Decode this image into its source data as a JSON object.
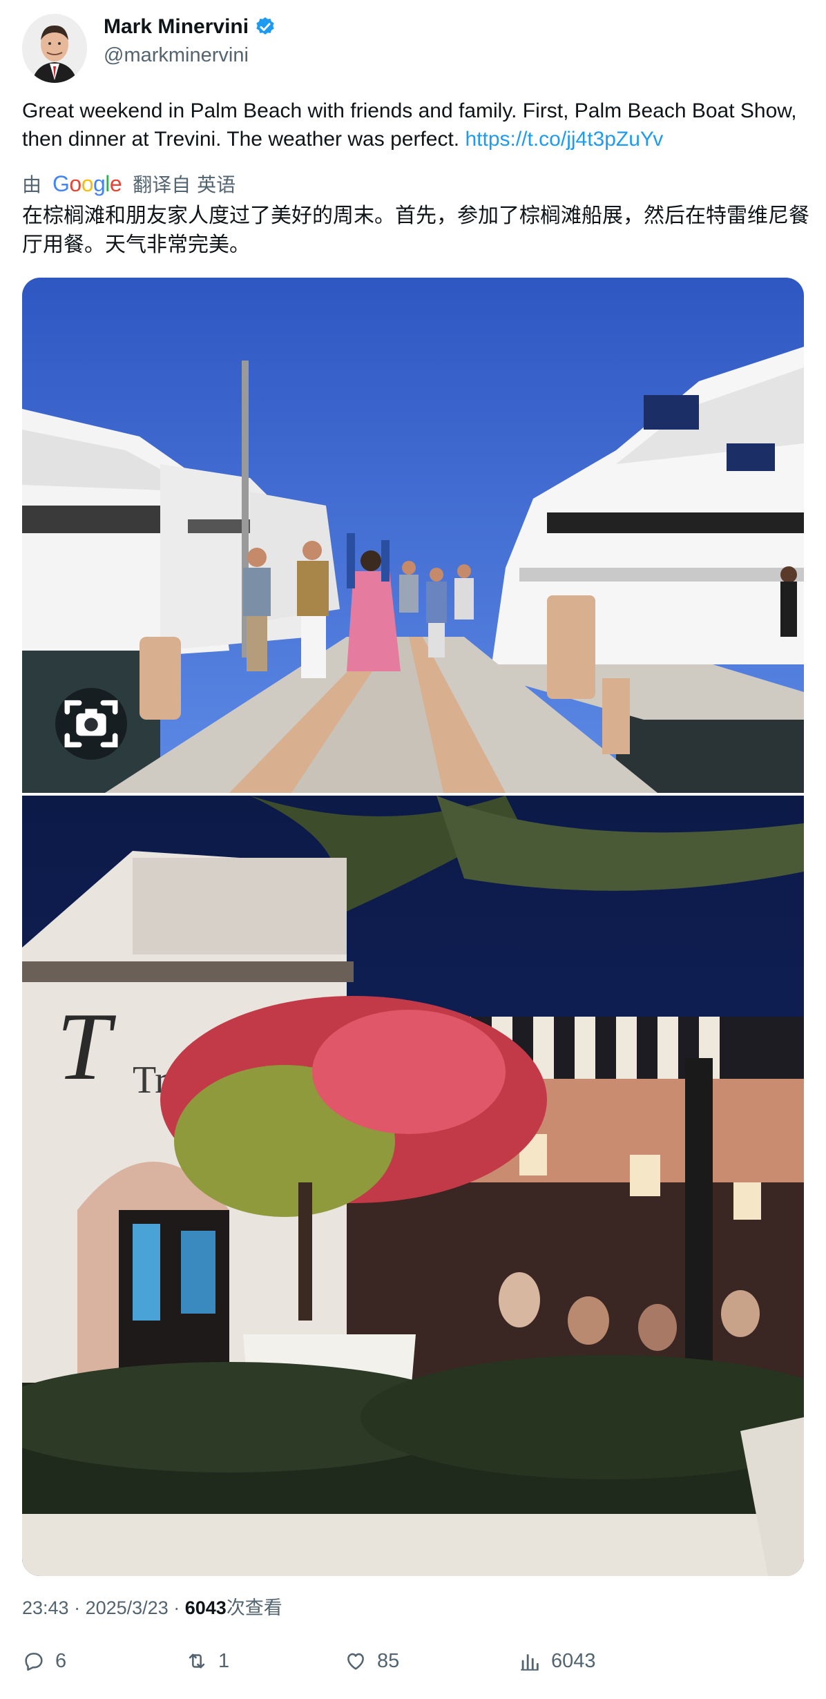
{
  "author": {
    "name": "Mark Minervini",
    "handle": "@markminervini",
    "verified_color": "#1d9bf0"
  },
  "tweet": {
    "text": "Great weekend in Palm Beach with friends and family. First, Palm Beach Boat Show, then dinner at Trevini. The weather was perfect.",
    "link": "https://t.co/jj4t3pZuYv"
  },
  "translation": {
    "prefix": "由",
    "provider": "Google",
    "suffix": "翻译自 英语",
    "text": "在棕榈滩和朋友家人度过了美好的周末。首先，参加了棕榈滩船展，然后在特雷维尼餐厅用餐。天气非常完美。"
  },
  "media": {
    "photo_top": "boat-show-dock-photo",
    "photo_bottom": "trevini-restaurant-photo",
    "sign_text": "Trevi"
  },
  "meta": {
    "time": "23:43",
    "date": "2025/3/23",
    "views": "6043",
    "views_label": "次查看"
  },
  "actions": {
    "replies": "6",
    "retweets": "1",
    "likes": "85",
    "views": "6043"
  }
}
